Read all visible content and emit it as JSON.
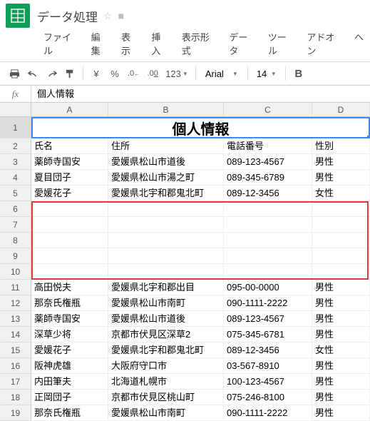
{
  "doc": {
    "title": "データ処理"
  },
  "menu": {
    "file": "ファイル",
    "edit": "編集",
    "view": "表示",
    "insert": "挿入",
    "format": "表示形式",
    "data": "データ",
    "tools": "ツール",
    "addons": "アドオン",
    "help": "ヘ"
  },
  "toolbar": {
    "font": "Arial",
    "size": "14",
    "yen": "¥",
    "percent": "%",
    "dec_dec": ".0",
    "dec_inc": ".00",
    "num_format": "123",
    "bold": "B"
  },
  "fx": {
    "label": "fx",
    "value": "個人情報"
  },
  "columns": {
    "A": "A",
    "B": "B",
    "C": "C",
    "D": "D"
  },
  "header_row": {
    "merged_title": "個人情報"
  },
  "headers": {
    "name": "氏名",
    "address": "住所",
    "phone": "電話番号",
    "gender": "性別"
  },
  "rows": {
    "r3": {
      "name": "薬師寺国安",
      "address": "愛媛県松山市道後",
      "phone": "089-123-4567",
      "gender": "男性"
    },
    "r4": {
      "name": "夏目団子",
      "address": "愛媛県松山市湯之町",
      "phone": "089-345-6789",
      "gender": "男性"
    },
    "r5": {
      "name": "愛媛花子",
      "address": "愛媛県北宇和郡鬼北町",
      "phone": "089-12-3456",
      "gender": "女性"
    },
    "r11": {
      "name": "高田悦夫",
      "address": "愛媛県北宇和郡出目",
      "phone": "095-00-0000",
      "gender": "男性"
    },
    "r12": {
      "name": "那奈氏権瓶",
      "address": "愛媛県松山市南町",
      "phone": "090-1111-2222",
      "gender": "男性"
    },
    "r13": {
      "name": "薬師寺国安",
      "address": "愛媛県松山市道後",
      "phone": "089-123-4567",
      "gender": "男性"
    },
    "r14": {
      "name": "深草少将",
      "address": "京都市伏見区深草2",
      "phone": "075-345-6781",
      "gender": "男性"
    },
    "r15": {
      "name": "愛媛花子",
      "address": "愛媛県北宇和郡鬼北町",
      "phone": "089-12-3456",
      "gender": "女性"
    },
    "r16": {
      "name": "阪神虎雄",
      "address": "大阪府守口市",
      "phone": "03-567-8910",
      "gender": "男性"
    },
    "r17": {
      "name": "内田筆夫",
      "address": "北海道札幌市",
      "phone": "100-123-4567",
      "gender": "男性"
    },
    "r18": {
      "name": "正岡団子",
      "address": "京都市伏見区桃山町",
      "phone": "075-246-8100",
      "gender": "男性"
    },
    "r19": {
      "name": "那奈氏権瓶",
      "address": "愛媛県松山市南町",
      "phone": "090-1111-2222",
      "gender": "男性"
    }
  },
  "row_numbers": {
    "n1": "1",
    "n2": "2",
    "n3": "3",
    "n4": "4",
    "n5": "5",
    "n6": "6",
    "n7": "7",
    "n8": "8",
    "n9": "9",
    "n10": "10",
    "n11": "11",
    "n12": "12",
    "n13": "13",
    "n14": "14",
    "n15": "15",
    "n16": "16",
    "n17": "17",
    "n18": "18",
    "n19": "19"
  }
}
